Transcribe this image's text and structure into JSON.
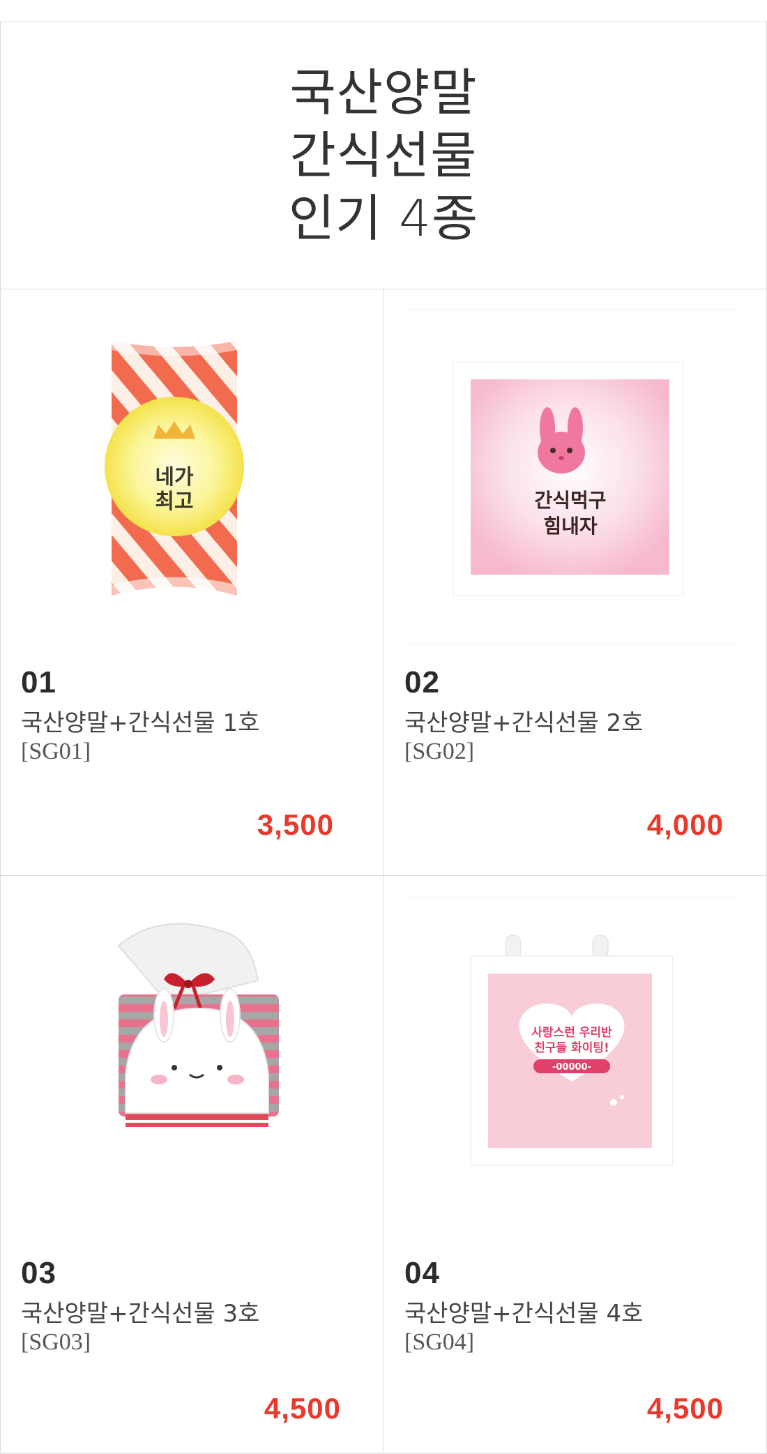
{
  "hero": {
    "line1": "국산양말",
    "line2": "간식선물",
    "line3": "인기 4종"
  },
  "products": [
    {
      "num": "01",
      "name": "국산양말+간식선물 1호",
      "code": "[SG01]",
      "price": "3,500",
      "image_text": [
        "네가",
        "최고"
      ]
    },
    {
      "num": "02",
      "name": "국산양말+간식선물 2호",
      "code": "[SG02]",
      "price": "4,000",
      "image_text": [
        "간식먹구",
        "힘내자"
      ]
    },
    {
      "num": "03",
      "name": "국산양말+간식선물 3호",
      "code": "[SG03]",
      "price": "4,500"
    },
    {
      "num": "04",
      "name": "국산양말+간식선물 4호",
      "code": "[SG04]",
      "price": "4,500",
      "image_text": [
        "사랑스런 우리반",
        "친구들 화이팅!",
        "-00000-"
      ]
    }
  ],
  "colors": {
    "price": "#e8392b",
    "text": "#333333"
  }
}
